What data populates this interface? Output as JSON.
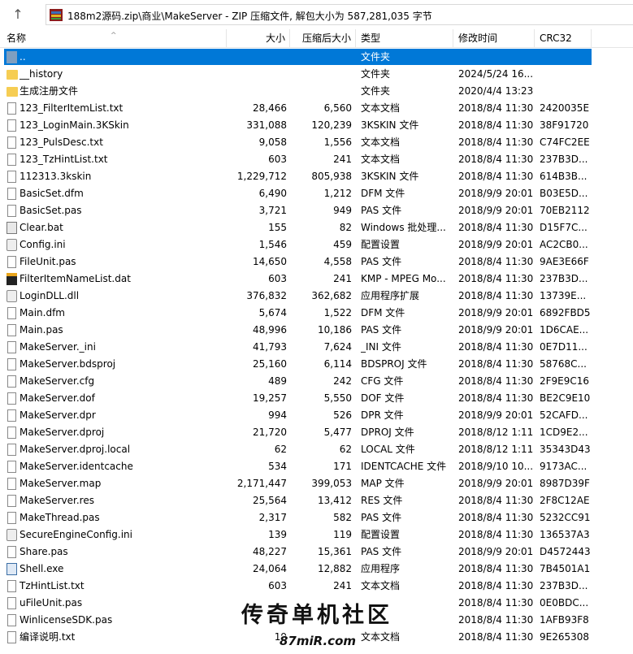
{
  "toolbar": {
    "up_icon": "arrow-up-icon",
    "path": "188m2源码.zip\\商业\\MakeServer - ZIP 压缩文件, 解包大小为 587,281,035 字节"
  },
  "columns": {
    "name": "名称",
    "size": "大小",
    "packed": "压缩后大小",
    "type": "类型",
    "mtime": "修改时间",
    "crc": "CRC32"
  },
  "rows": [
    {
      "name": "..",
      "size": "",
      "packed": "",
      "type": "文件夹",
      "mtime": "",
      "crc": "",
      "icon": "up-folder-icon"
    },
    {
      "name": "__history",
      "size": "",
      "packed": "",
      "type": "文件夹",
      "mtime": "2024/5/24 16...",
      "crc": "",
      "icon": "folder-icon"
    },
    {
      "name": "生成注册文件",
      "size": "",
      "packed": "",
      "type": "文件夹",
      "mtime": "2020/4/4 13:23",
      "crc": "",
      "icon": "folder-icon"
    },
    {
      "name": "123_FilterItemList.txt",
      "size": "28,466",
      "packed": "6,560",
      "type": "文本文档",
      "mtime": "2018/8/4 11:30",
      "crc": "2420035E",
      "icon": "document-icon"
    },
    {
      "name": "123_LoginMain.3KSkin",
      "size": "331,088",
      "packed": "120,239",
      "type": "3KSKIN 文件",
      "mtime": "2018/8/4 11:30",
      "crc": "38F91720",
      "icon": "document-icon"
    },
    {
      "name": "123_PulsDesc.txt",
      "size": "9,058",
      "packed": "1,556",
      "type": "文本文档",
      "mtime": "2018/8/4 11:30",
      "crc": "C74FC2EE",
      "icon": "document-icon"
    },
    {
      "name": "123_TzHintList.txt",
      "size": "603",
      "packed": "241",
      "type": "文本文档",
      "mtime": "2018/8/4 11:30",
      "crc": "237B3D...",
      "icon": "document-icon"
    },
    {
      "name": "112313.3kskin",
      "size": "1,229,712",
      "packed": "805,938",
      "type": "3KSKIN 文件",
      "mtime": "2018/8/4 11:30",
      "crc": "614B3B...",
      "icon": "document-icon"
    },
    {
      "name": "BasicSet.dfm",
      "size": "6,490",
      "packed": "1,212",
      "type": "DFM 文件",
      "mtime": "2018/9/9 20:01",
      "crc": "B03E5D...",
      "icon": "document-icon"
    },
    {
      "name": "BasicSet.pas",
      "size": "3,721",
      "packed": "949",
      "type": "PAS 文件",
      "mtime": "2018/9/9 20:01",
      "crc": "70EB2112",
      "icon": "document-icon"
    },
    {
      "name": "Clear.bat",
      "size": "155",
      "packed": "82",
      "type": "Windows 批处理...",
      "mtime": "2018/8/4 11:30",
      "crc": "D15F7C...",
      "icon": "batch-file-icon"
    },
    {
      "name": "Config.ini",
      "size": "1,546",
      "packed": "459",
      "type": "配置设置",
      "mtime": "2018/9/9 20:01",
      "crc": "AC2CB0...",
      "icon": "config-file-icon"
    },
    {
      "name": "FileUnit.pas",
      "size": "14,650",
      "packed": "4,558",
      "type": "PAS 文件",
      "mtime": "2018/8/4 11:30",
      "crc": "9AE3E66F",
      "icon": "document-icon"
    },
    {
      "name": "FilterItemNameList.dat",
      "size": "603",
      "packed": "241",
      "type": "KMP - MPEG Mo...",
      "mtime": "2018/8/4 11:30",
      "crc": "237B3D...",
      "icon": "dat-file-icon"
    },
    {
      "name": "LoginDLL.dll",
      "size": "376,832",
      "packed": "362,682",
      "type": "应用程序扩展",
      "mtime": "2018/8/4 11:30",
      "crc": "13739E...",
      "icon": "dll-file-icon"
    },
    {
      "name": "Main.dfm",
      "size": "5,674",
      "packed": "1,522",
      "type": "DFM 文件",
      "mtime": "2018/9/9 20:01",
      "crc": "6892FBD5",
      "icon": "document-icon"
    },
    {
      "name": "Main.pas",
      "size": "48,996",
      "packed": "10,186",
      "type": "PAS 文件",
      "mtime": "2018/9/9 20:01",
      "crc": "1D6CAE...",
      "icon": "document-icon"
    },
    {
      "name": "MakeServer._ini",
      "size": "41,793",
      "packed": "7,624",
      "type": "_INI 文件",
      "mtime": "2018/8/4 11:30",
      "crc": "0E7D11...",
      "icon": "document-icon"
    },
    {
      "name": "MakeServer.bdsproj",
      "size": "25,160",
      "packed": "6,114",
      "type": "BDSPROJ 文件",
      "mtime": "2018/8/4 11:30",
      "crc": "58768C...",
      "icon": "document-icon"
    },
    {
      "name": "MakeServer.cfg",
      "size": "489",
      "packed": "242",
      "type": "CFG 文件",
      "mtime": "2018/8/4 11:30",
      "crc": "2F9E9C16",
      "icon": "document-icon"
    },
    {
      "name": "MakeServer.dof",
      "size": "19,257",
      "packed": "5,550",
      "type": "DOF 文件",
      "mtime": "2018/8/4 11:30",
      "crc": "BE2C9E10",
      "icon": "document-icon"
    },
    {
      "name": "MakeServer.dpr",
      "size": "994",
      "packed": "526",
      "type": "DPR 文件",
      "mtime": "2018/9/9 20:01",
      "crc": "52CAFD...",
      "icon": "document-icon"
    },
    {
      "name": "MakeServer.dproj",
      "size": "21,720",
      "packed": "5,477",
      "type": "DPROJ 文件",
      "mtime": "2018/8/12 1:11",
      "crc": "1CD9E2...",
      "icon": "document-icon"
    },
    {
      "name": "MakeServer.dproj.local",
      "size": "62",
      "packed": "62",
      "type": "LOCAL 文件",
      "mtime": "2018/8/12 1:11",
      "crc": "35343D43",
      "icon": "document-icon"
    },
    {
      "name": "MakeServer.identcache",
      "size": "534",
      "packed": "171",
      "type": "IDENTCACHE 文件",
      "mtime": "2018/9/10 10...",
      "crc": "9173AC...",
      "icon": "document-icon"
    },
    {
      "name": "MakeServer.map",
      "size": "2,171,447",
      "packed": "399,053",
      "type": "MAP 文件",
      "mtime": "2018/9/9 20:01",
      "crc": "8987D39F",
      "icon": "document-icon"
    },
    {
      "name": "MakeServer.res",
      "size": "25,564",
      "packed": "13,412",
      "type": "RES 文件",
      "mtime": "2018/8/4 11:30",
      "crc": "2F8C12AE",
      "icon": "document-icon"
    },
    {
      "name": "MakeThread.pas",
      "size": "2,317",
      "packed": "582",
      "type": "PAS 文件",
      "mtime": "2018/8/4 11:30",
      "crc": "5232CC91",
      "icon": "document-icon"
    },
    {
      "name": "SecureEngineConfig.ini",
      "size": "139",
      "packed": "119",
      "type": "配置设置",
      "mtime": "2018/8/4 11:30",
      "crc": "136537A3",
      "icon": "config-file-icon"
    },
    {
      "name": "Share.pas",
      "size": "48,227",
      "packed": "15,361",
      "type": "PAS 文件",
      "mtime": "2018/9/9 20:01",
      "crc": "D4572443",
      "icon": "document-icon"
    },
    {
      "name": "Shell.exe",
      "size": "24,064",
      "packed": "12,882",
      "type": "应用程序",
      "mtime": "2018/8/4 11:30",
      "crc": "7B4501A1",
      "icon": "exe-file-icon"
    },
    {
      "name": "TzHintList.txt",
      "size": "603",
      "packed": "241",
      "type": "文本文档",
      "mtime": "2018/8/4 11:30",
      "crc": "237B3D...",
      "icon": "document-icon"
    },
    {
      "name": "uFileUnit.pas",
      "size": "",
      "packed": "",
      "type": "",
      "mtime": "2018/8/4 11:30",
      "crc": "0E0BDC...",
      "icon": "document-icon"
    },
    {
      "name": "WinlicenseSDK.pas",
      "size": "",
      "packed": "",
      "type": "",
      "mtime": "2018/8/4 11:30",
      "crc": "1AFB93F8",
      "icon": "document-icon"
    },
    {
      "name": "编译说明.txt",
      "size": "19",
      "packed": "",
      "type": "文本文档",
      "mtime": "2018/8/4 11:30",
      "crc": "9E265308",
      "icon": "document-icon"
    }
  ],
  "watermark": {
    "title": "传奇单机社区",
    "subtitle": "87miR.com"
  }
}
